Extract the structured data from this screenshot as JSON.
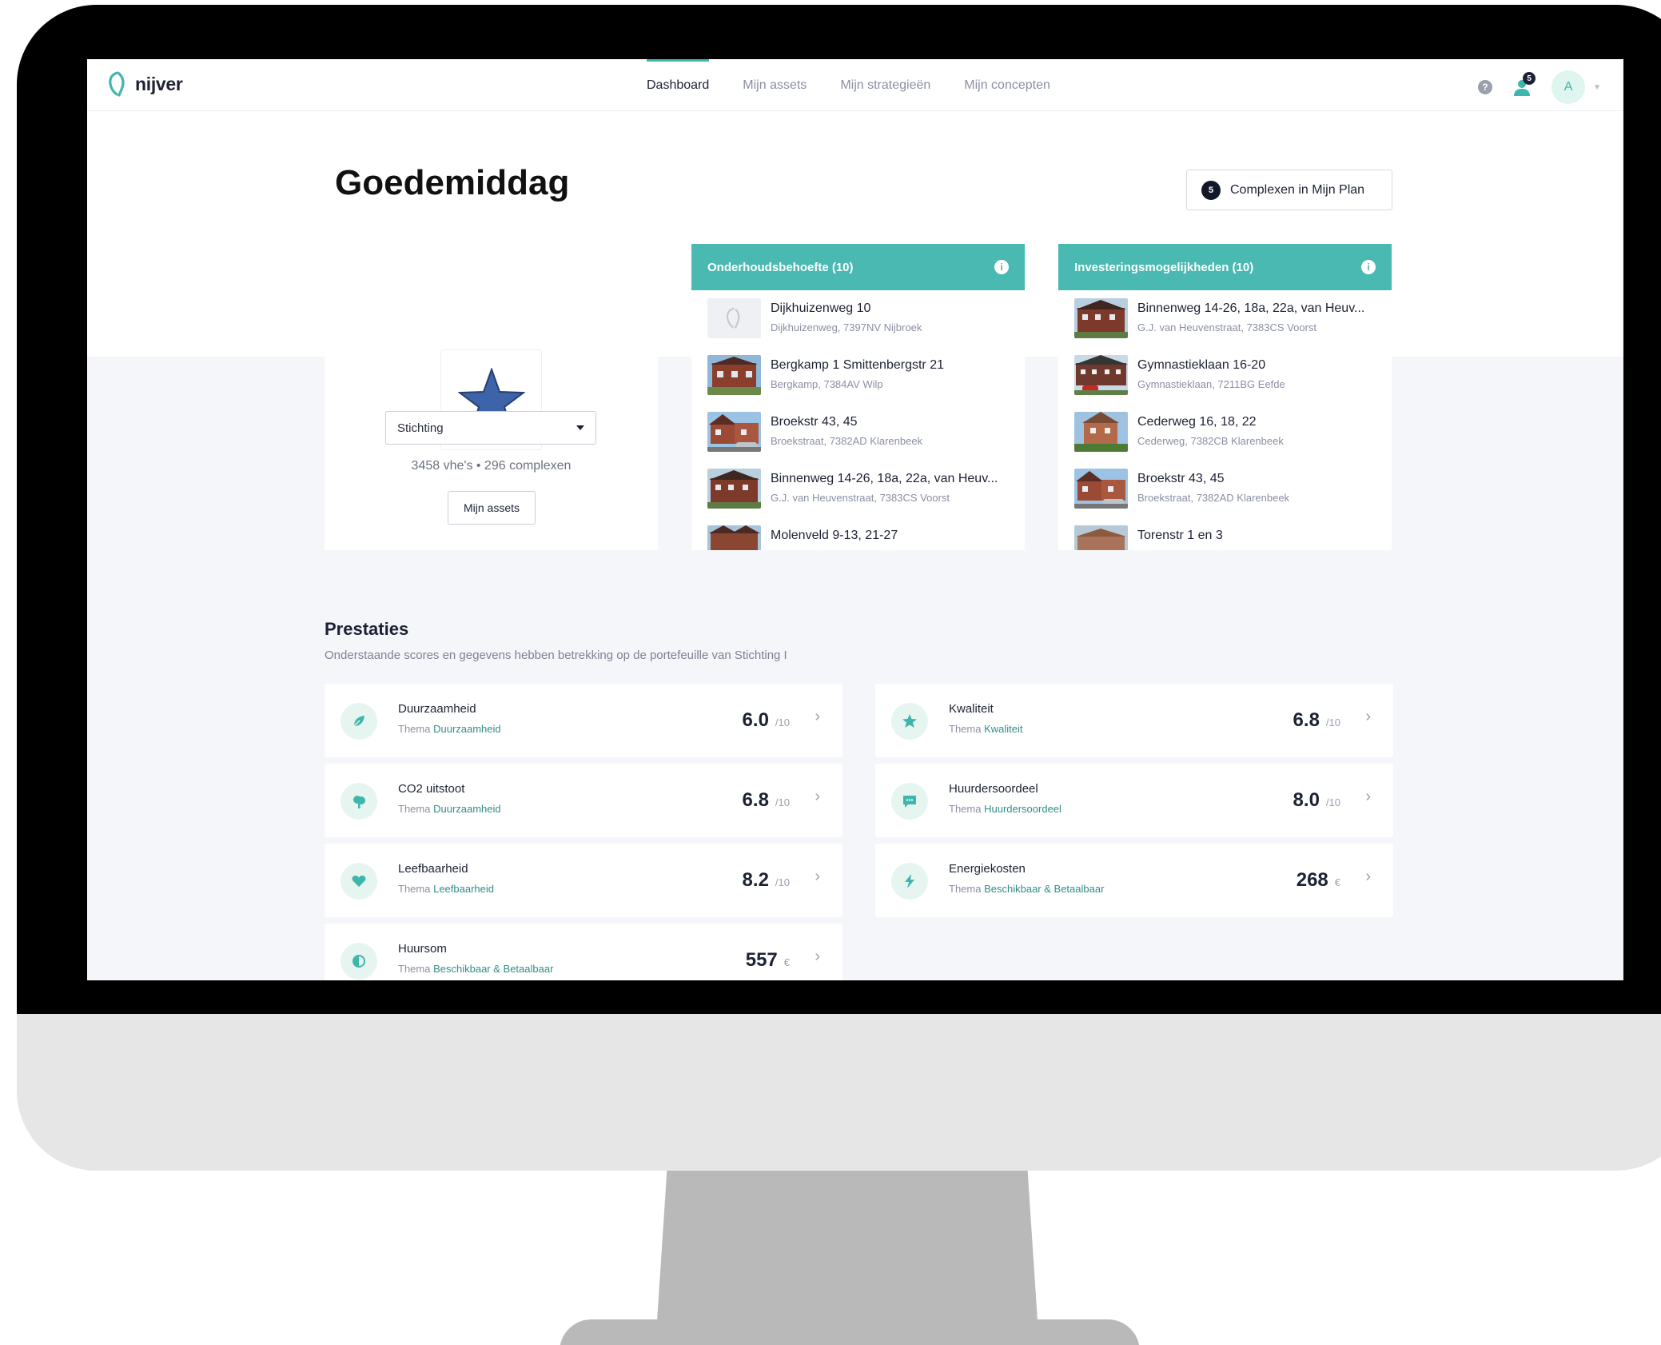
{
  "app": {
    "logo_text": "nijver",
    "accent_color": "#49b9b1",
    "nav": [
      {
        "label": "Dashboard",
        "active": true
      },
      {
        "label": "Mijn assets",
        "active": false
      },
      {
        "label": "Mijn strategieën",
        "active": false
      },
      {
        "label": "Mijn concepten",
        "active": false
      }
    ],
    "notification_count": "5",
    "avatar_initial": "A"
  },
  "dashboard": {
    "greeting": "Goedemiddag",
    "plan_button": {
      "count": "5",
      "label": "Complexen in Mijn Plan"
    }
  },
  "organization": {
    "select_value": "Stichting",
    "stats": "3458 vhe's • 296 complexen",
    "assets_button": "Mijn assets"
  },
  "maintenance": {
    "title": "Onderhoudsbehoefte (10)",
    "items": [
      {
        "name": "Dijkhuizenweg 10",
        "address": "Dijkhuizenweg, 7397NV Nijbroek",
        "thumb": "placeholder"
      },
      {
        "name": "Bergkamp 1 Smittenbergstr 21",
        "address": "Bergkamp, 7384AV Wilp",
        "thumb": "photo"
      },
      {
        "name": "Broekstr 43, 45",
        "address": "Broekstraat, 7382AD Klarenbeek",
        "thumb": "photo"
      },
      {
        "name": "Binnenweg 14-26, 18a, 22a, van Heuv...",
        "address": "G.J. van Heuvenstraat, 7383CS Voorst",
        "thumb": "photo"
      },
      {
        "name": "Molenveld 9-13, 21-27",
        "address": "",
        "thumb": "photo"
      }
    ]
  },
  "investment": {
    "title": "Investeringsmogelijkheden (10)",
    "items": [
      {
        "name": "Binnenweg 14-26, 18a, 22a, van Heuv...",
        "address": "G.J. van Heuvenstraat, 7383CS Voorst",
        "thumb": "photo"
      },
      {
        "name": "Gymnastieklaan 16-20",
        "address": "Gymnastieklaan, 7211BG Eefde",
        "thumb": "photo"
      },
      {
        "name": "Cederweg 16, 18, 22",
        "address": "Cederweg, 7382CB Klarenbeek",
        "thumb": "photo"
      },
      {
        "name": "Broekstr 43, 45",
        "address": "Broekstraat, 7382AD Klarenbeek",
        "thumb": "photo"
      },
      {
        "name": "Torenstr 1 en 3",
        "address": "",
        "thumb": "photo"
      }
    ]
  },
  "performance": {
    "title": "Prestaties",
    "subtitle": "Onderstaande scores en gegevens hebben betrekking op de portefeuille van Stichting I",
    "kpis": [
      {
        "name": "Duurzaamheid",
        "theme_prefix": "Thema",
        "theme": "Duurzaamheid",
        "value": "6.0",
        "unit": "/10",
        "icon": "leaf-icon"
      },
      {
        "name": "Kwaliteit",
        "theme_prefix": "Thema",
        "theme": "Kwaliteit",
        "value": "6.8",
        "unit": "/10",
        "icon": "star-icon"
      },
      {
        "name": "CO2 uitstoot",
        "theme_prefix": "Thema",
        "theme": "Duurzaamheid",
        "value": "6.8",
        "unit": "/10",
        "icon": "tree-icon"
      },
      {
        "name": "Huurdersoordeel",
        "theme_prefix": "Thema",
        "theme": "Huurdersoordeel",
        "value": "8.0",
        "unit": "/10",
        "icon": "chat-icon"
      },
      {
        "name": "Leefbaarheid",
        "theme_prefix": "Thema",
        "theme": "Leefbaarheid",
        "value": "8.2",
        "unit": "/10",
        "icon": "heart-icon"
      },
      {
        "name": "Energiekosten",
        "theme_prefix": "Thema",
        "theme": "Beschikbaar & Betaalbaar",
        "value": "268",
        "unit": "€",
        "icon": "bolt-icon"
      },
      {
        "name": "Huursom",
        "theme_prefix": "Thema",
        "theme": "Beschikbaar & Betaalbaar",
        "value": "557",
        "unit": "€",
        "icon": "coin-icon"
      }
    ]
  }
}
